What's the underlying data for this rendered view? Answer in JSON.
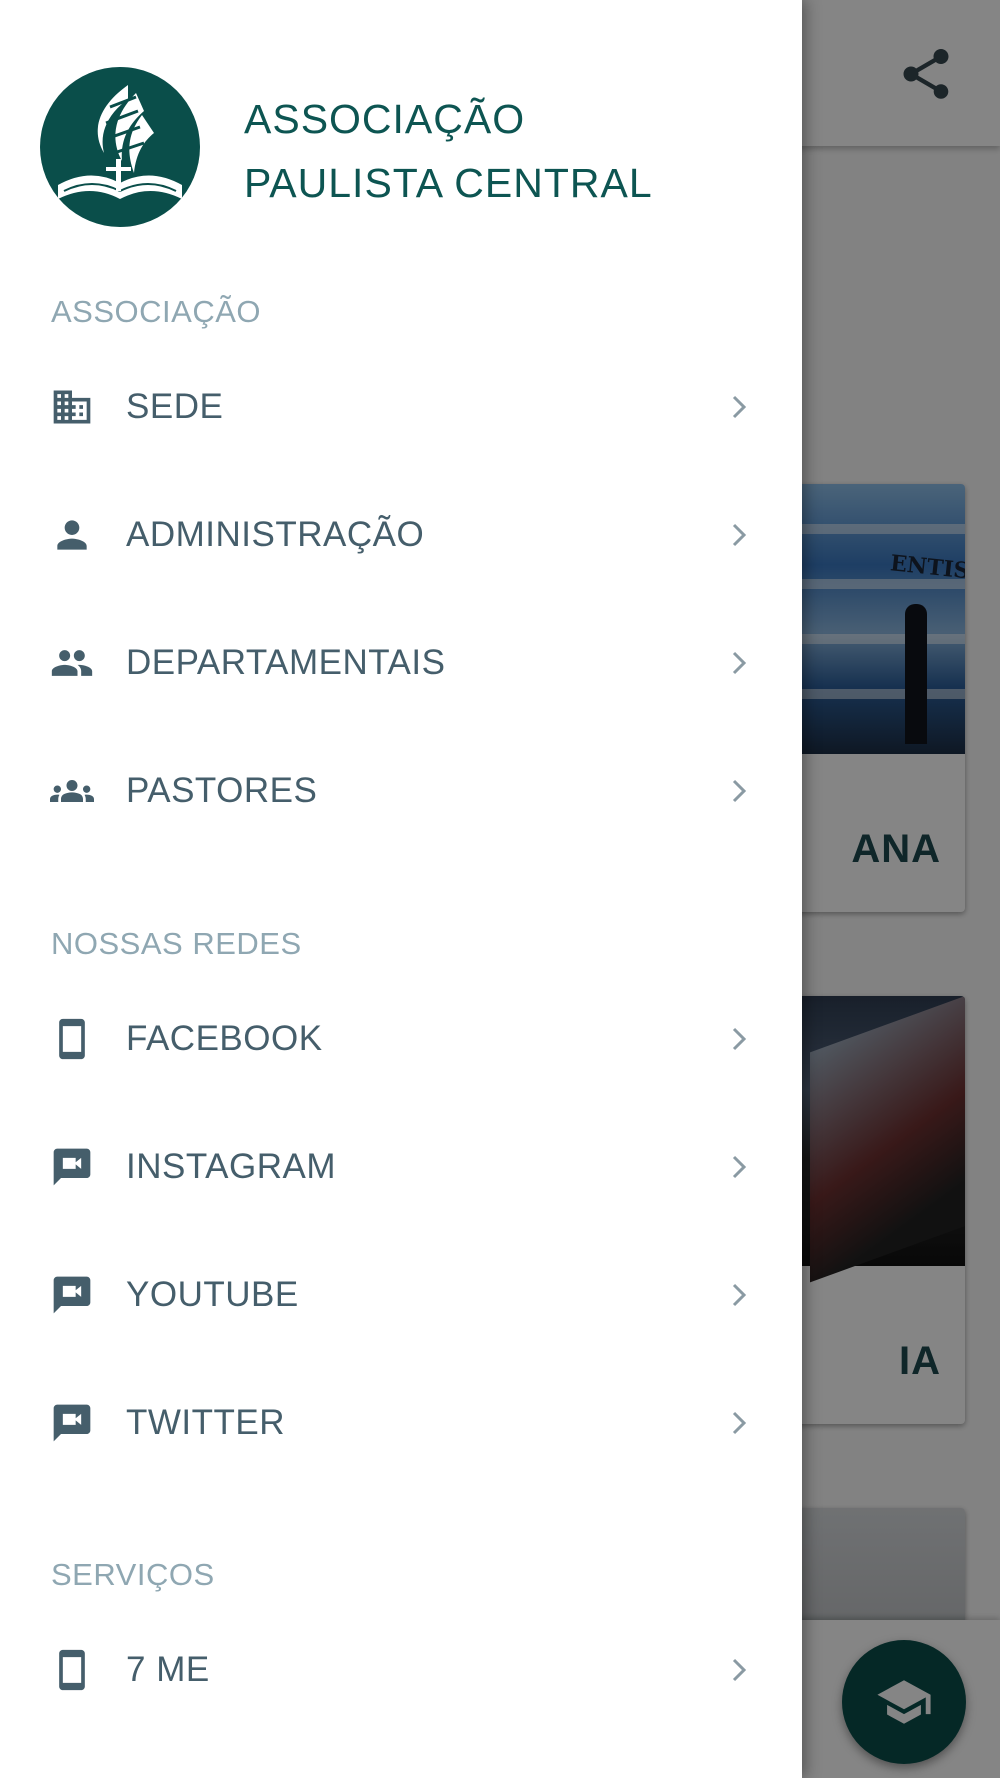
{
  "drawer": {
    "header": {
      "org_name_line1": "ASSOCIAÇÃO",
      "org_name_line2": "PAULISTA CENTRAL"
    },
    "sections": [
      {
        "title": "ASSOCIAÇÃO",
        "items": [
          {
            "label": "SEDE",
            "icon": "building-icon"
          },
          {
            "label": "ADMINISTRAÇÃO",
            "icon": "person-icon"
          },
          {
            "label": "DEPARTAMENTAIS",
            "icon": "people-icon"
          },
          {
            "label": "PASTORES",
            "icon": "groups-icon"
          }
        ]
      },
      {
        "title": "NOSSAS REDES",
        "items": [
          {
            "label": "FACEBOOK",
            "icon": "smartphone-icon"
          },
          {
            "label": "INSTAGRAM",
            "icon": "video-chat-icon"
          },
          {
            "label": "YOUTUBE",
            "icon": "video-chat-icon"
          },
          {
            "label": "TWITTER",
            "icon": "video-chat-icon"
          }
        ]
      },
      {
        "title": "SERVIÇOS",
        "items": [
          {
            "label": "7 ME",
            "icon": "smartphone-icon"
          }
        ]
      }
    ]
  },
  "background": {
    "cards": [
      {
        "title_visible": "ANA",
        "sign_text": "ENTISTA"
      },
      {
        "title_visible": "IA"
      },
      {
        "title_visible": ""
      }
    ],
    "fab_icon": "graduation-cap-icon",
    "share_icon": "share-icon"
  },
  "colors": {
    "brand": "#0a4e4a",
    "drawer_text": "#455e6b",
    "section_title": "#8fa7b2",
    "org_name": "#0d5552"
  }
}
